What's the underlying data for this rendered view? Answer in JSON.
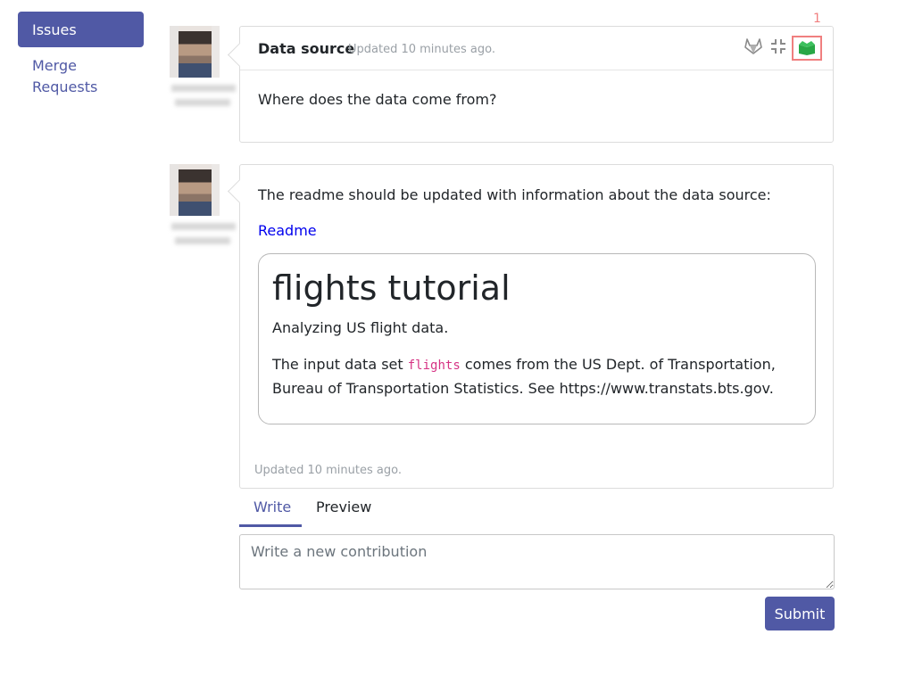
{
  "sidebar": {
    "items": [
      {
        "label": "Issues",
        "active": true
      },
      {
        "label": "Merge Requests",
        "active": false
      }
    ]
  },
  "comment1": {
    "title": "Data source",
    "updated": "Updated 10 minutes ago.",
    "body": "Where does the data come from?",
    "actions": {
      "badge_number": "1",
      "icons": [
        "gitlab-icon",
        "collapse-icon",
        "open-box-icon"
      ]
    }
  },
  "comment2": {
    "body": "The readme should be updated with information about the data source:",
    "link_label": "Readme",
    "readme": {
      "title": "flights tutorial",
      "subtitle": "Analyzing US flight data.",
      "text_before_code": "The input data set ",
      "code": "flights",
      "text_after_code": " comes from the US Dept. of Transportation, Bureau of Transportation Statistics. See https://www.transtats.bts.gov."
    },
    "updated": "Updated 10 minutes ago."
  },
  "editor": {
    "tabs": [
      {
        "label": "Write",
        "active": true
      },
      {
        "label": "Preview",
        "active": false
      }
    ],
    "placeholder": "Write a new contribution",
    "submit_label": "Submit"
  },
  "colors": {
    "accent": "#5059a5",
    "link": "#0000ee",
    "highlight_border": "#f07f7f",
    "box_icon": "#28a745",
    "code": "#d63384"
  }
}
